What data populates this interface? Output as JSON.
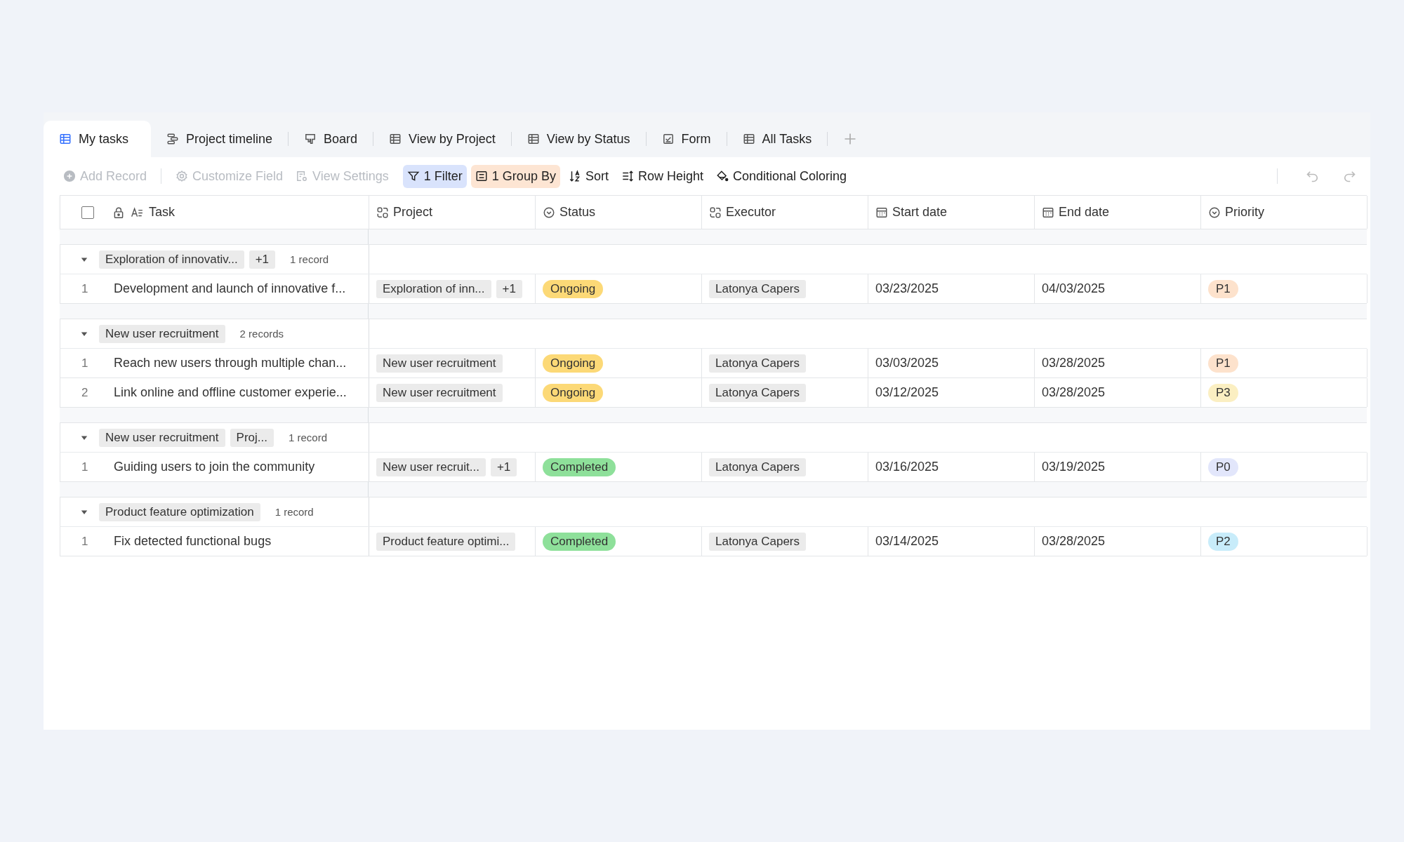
{
  "tabs": [
    {
      "label": "My tasks",
      "kind": "grid",
      "selected": true
    },
    {
      "label": "Project timeline",
      "kind": "timeline",
      "selected": false
    },
    {
      "label": "Board",
      "kind": "board",
      "selected": false
    },
    {
      "label": "View by Project",
      "kind": "grid",
      "selected": false
    },
    {
      "label": "View by Status",
      "kind": "grid",
      "selected": false
    },
    {
      "label": "Form",
      "kind": "form",
      "selected": false
    },
    {
      "label": "All Tasks",
      "kind": "grid",
      "selected": false
    }
  ],
  "toolbar": [
    {
      "label": "Add Record",
      "kind": "add",
      "disabled": true
    },
    {
      "label": "Customize Field",
      "kind": "field",
      "disabled": true
    },
    {
      "label": "View Settings",
      "kind": "settings",
      "disabled": true
    },
    {
      "label": "1 Filter",
      "kind": "filter",
      "disabled": false
    },
    {
      "label": "1 Group By",
      "kind": "group",
      "disabled": false
    },
    {
      "label": "Sort",
      "kind": "sort",
      "disabled": false
    },
    {
      "label": "Row Height",
      "kind": "height",
      "disabled": false
    },
    {
      "label": "Conditional Coloring",
      "kind": "coloring",
      "disabled": false
    }
  ],
  "select_all": {
    "checked": false
  },
  "columns": [
    {
      "label": "Task",
      "kind": "text"
    },
    {
      "label": "Project",
      "kind": "link"
    },
    {
      "label": "Status",
      "kind": "select"
    },
    {
      "label": "Executor",
      "kind": "link"
    },
    {
      "label": "Start date",
      "kind": "date"
    },
    {
      "label": "End date",
      "kind": "date"
    },
    {
      "label": "Priority",
      "kind": "select"
    }
  ],
  "groups": [
    {
      "chips": [
        "Exploration of innovativ...",
        "+1"
      ],
      "count": "1 record",
      "records": [
        {
          "index": "1",
          "task": "Development and launch of innovative f...",
          "project": [
            "Exploration of inn...",
            "+1"
          ],
          "status": {
            "label": "Ongoing",
            "color": "#fcd977"
          },
          "executor": "Latonya Capers",
          "start": "03/23/2025",
          "end": "04/03/2025",
          "priority": {
            "label": "P1",
            "color": "#fde2cc"
          }
        }
      ]
    },
    {
      "chips": [
        "New user recruitment"
      ],
      "count": "2 records",
      "records": [
        {
          "index": "1",
          "task": "Reach new users through multiple chan...",
          "project": [
            "New user recruitment"
          ],
          "status": {
            "label": "Ongoing",
            "color": "#fcd977"
          },
          "executor": "Latonya Capers",
          "start": "03/03/2025",
          "end": "03/28/2025",
          "priority": {
            "label": "P1",
            "color": "#fde2cc"
          }
        },
        {
          "index": "2",
          "task": "Link online and offline customer experie...",
          "project": [
            "New user recruitment"
          ],
          "status": {
            "label": "Ongoing",
            "color": "#fcd977"
          },
          "executor": "Latonya Capers",
          "start": "03/12/2025",
          "end": "03/28/2025",
          "priority": {
            "label": "P3",
            "color": "#fbefc2"
          }
        }
      ]
    },
    {
      "chips": [
        "New user recruitment",
        "Proj..."
      ],
      "count": "1 record",
      "records": [
        {
          "index": "1",
          "task": "Guiding users to join the community",
          "project": [
            "New user recruit...",
            "+1"
          ],
          "status": {
            "label": "Completed",
            "color": "#8ee09a"
          },
          "executor": "Latonya Capers",
          "start": "03/16/2025",
          "end": "03/19/2025",
          "priority": {
            "label": "P0",
            "color": "#e2e6fb"
          }
        }
      ]
    },
    {
      "chips": [
        "Product feature optimization"
      ],
      "count": "1 record",
      "records": [
        {
          "index": "1",
          "task": "Fix detected functional bugs",
          "project": [
            "Product feature optimi..."
          ],
          "status": {
            "label": "Completed",
            "color": "#8ee09a"
          },
          "executor": "Latonya Capers",
          "start": "03/14/2025",
          "end": "03/28/2025",
          "priority": {
            "label": "P2",
            "color": "#c8ecfa"
          }
        }
      ]
    }
  ]
}
